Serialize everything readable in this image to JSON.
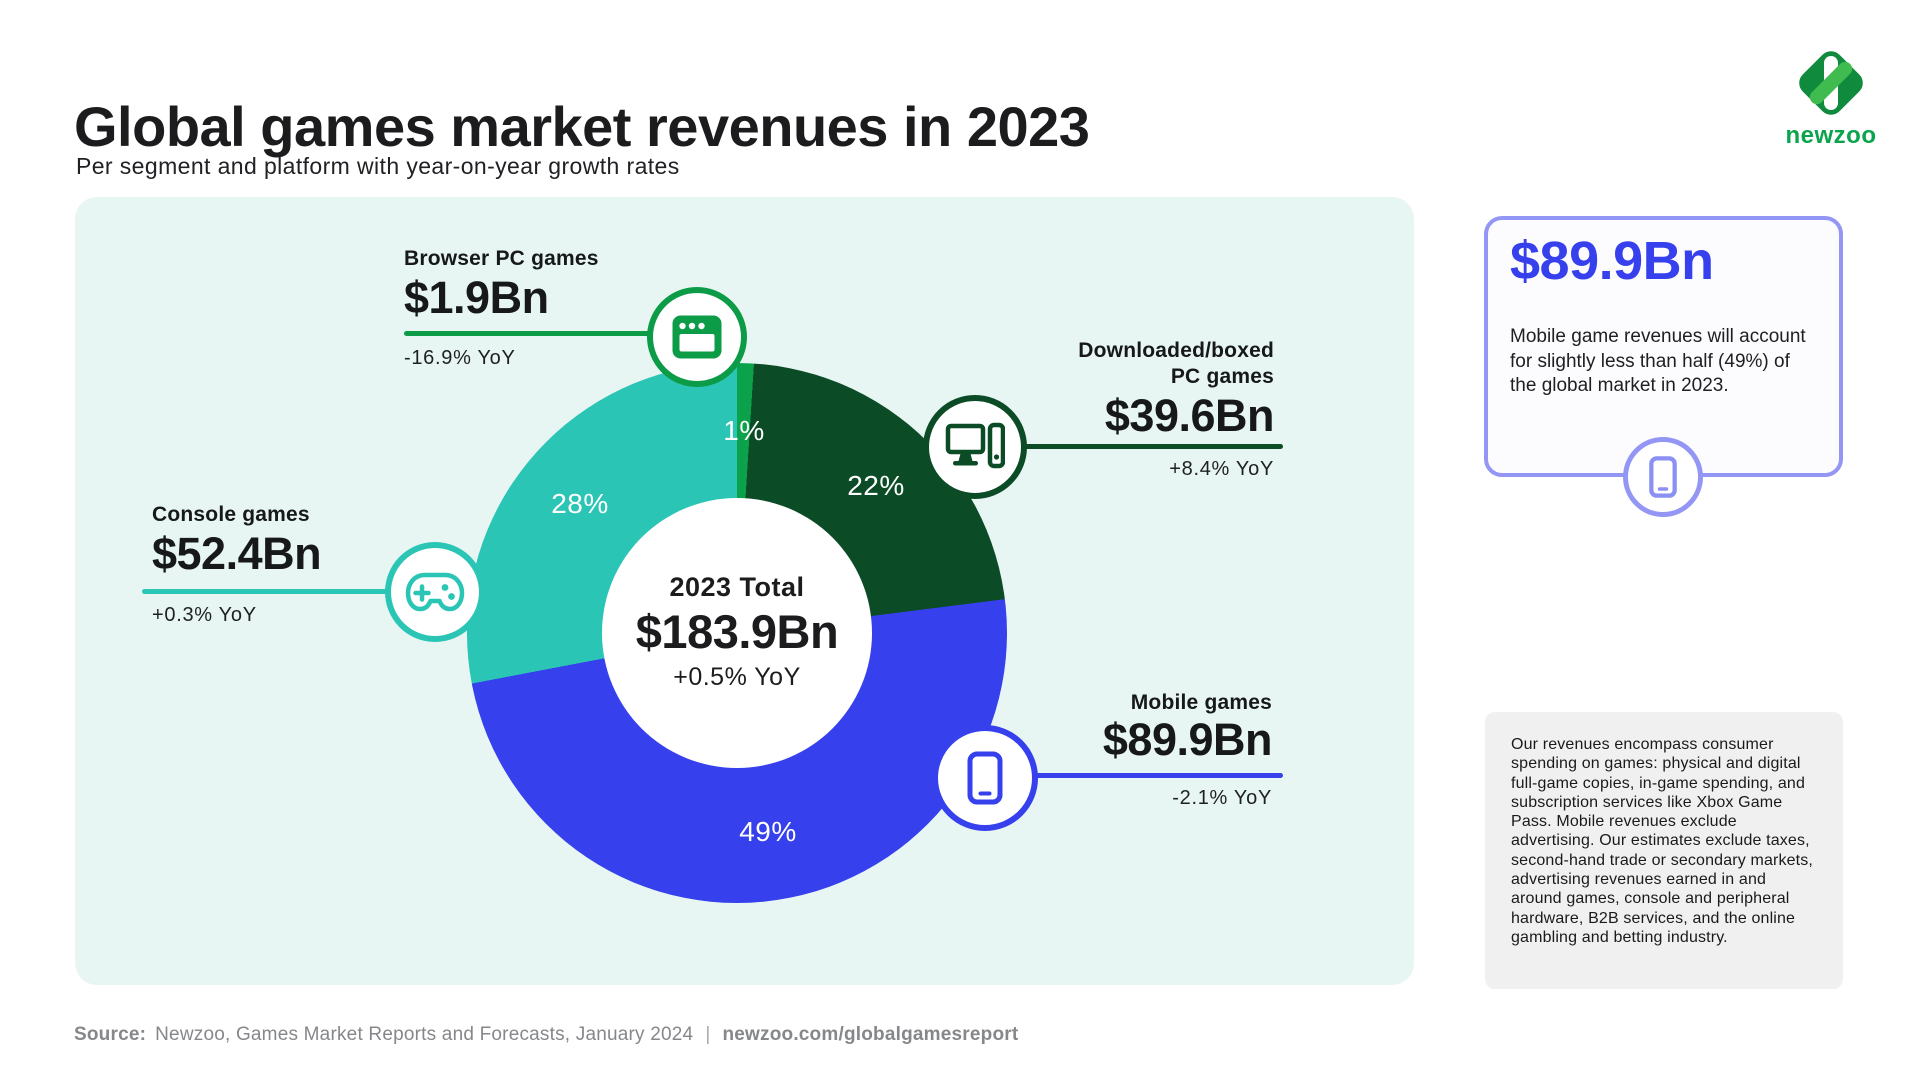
{
  "header": {
    "title": "Global games market revenues in 2023",
    "subtitle": "Per segment and platform with year-on-year growth rates"
  },
  "logo": {
    "wordmark": "newzoo"
  },
  "chart_data": {
    "type": "pie",
    "donut": true,
    "title": "Global games market revenues in 2023",
    "subtitle": "Per segment and platform with year-on-year growth rates",
    "units": "USD billions",
    "legend_position": "callouts-around-donut",
    "total": {
      "label": "2023 Total",
      "value": "$183.9Bn",
      "value_numeric": 183.9,
      "yoy": "+0.5% YoY"
    },
    "segments": [
      {
        "name": "Browser PC games",
        "value": "$1.9Bn",
        "value_numeric": 1.9,
        "yoy": "-16.9% YoY",
        "share_pct": 1,
        "share_label": "1%",
        "color": "#0CA24B",
        "icon": "browser-window-icon"
      },
      {
        "name": "Downloaded/boxed PC games",
        "value": "$39.6Bn",
        "value_numeric": 39.6,
        "yoy": "+8.4% YoY",
        "share_pct": 22,
        "share_label": "22%",
        "color": "#0B4C26",
        "icon": "desktop-pc-icon"
      },
      {
        "name": "Mobile games",
        "value": "$89.9Bn",
        "value_numeric": 89.9,
        "yoy": "-2.1% YoY",
        "share_pct": 49,
        "share_label": "49%",
        "color": "#3640EC",
        "icon": "smartphone-icon"
      },
      {
        "name": "Console games",
        "value": "$52.4Bn",
        "value_numeric": 52.4,
        "yoy": "+0.3% YoY",
        "share_pct": 28,
        "share_label": "28%",
        "color": "#2BC5B5",
        "icon": "gamepad-icon"
      }
    ]
  },
  "highlight_box": {
    "value": "$89.9Bn",
    "text": "Mobile game revenues will account for slightly less than half (49%) of the global market in 2023.",
    "icon": "smartphone-icon",
    "border_color": "#9396F4",
    "value_color": "#3640EC"
  },
  "note_box": {
    "text": "Our revenues encompass consumer spending on games: physical and digital full-game copies, in-game spending, and subscription services like Xbox Game Pass. Mobile revenues exclude advertising. Our estimates exclude taxes, second-hand trade or secondary markets, advertising revenues earned in and around games, console and peripheral hardware, B2B services, and the online gambling and betting industry."
  },
  "footer": {
    "source_label": "Source:",
    "source_text": "Newzoo, Games Market Reports and Forecasts, January 2024",
    "separator": "|",
    "link": "newzoo.com/globalgamesreport"
  }
}
